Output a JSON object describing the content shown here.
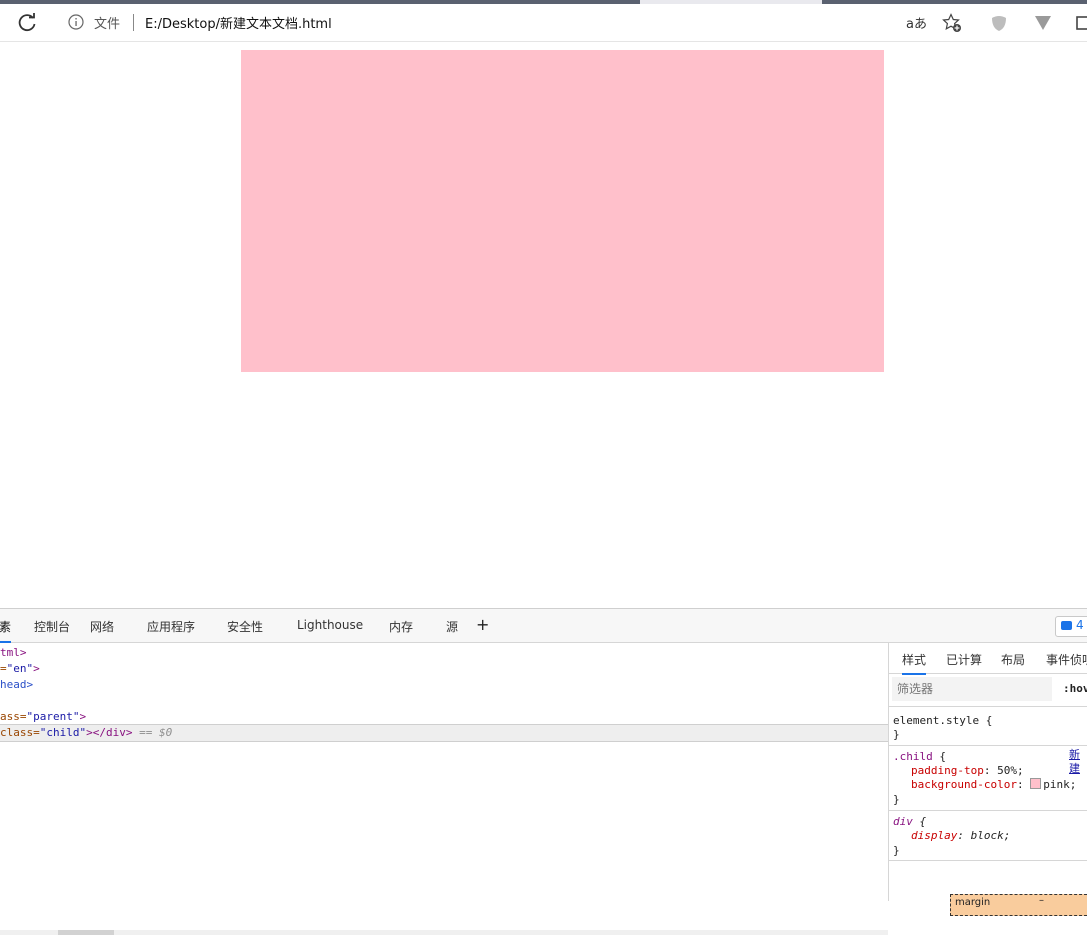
{
  "browser": {
    "file_label": "文件",
    "url": "E:/Desktop/新建文本文档.html",
    "read_aloud_label": "aあ",
    "icons": [
      "reload-icon",
      "info-icon",
      "favorites-star-icon",
      "extension-icon"
    ]
  },
  "page": {
    "child_color": "#ffc0cb"
  },
  "devtools": {
    "tabs": [
      "素",
      "控制台",
      "网络",
      "应用程序",
      "安全性",
      "Lighthouse",
      "内存",
      "源"
    ],
    "plus_label": "+",
    "issues_count": "4",
    "dom": {
      "line1_tag": "tml>",
      "line2_attr_tail": "=",
      "line2_val": "\"en\"",
      "line2_close": ">",
      "line3_tag": "head>",
      "line5_attr": "ass=",
      "line5_val": "\"parent\"",
      "line5_close": ">",
      "line6_attr": "class=",
      "line6_val": "\"child\"",
      "line6_close": "></div>",
      "line6_eq": "== $0"
    },
    "styles": {
      "tabs": [
        "样式",
        "已计算",
        "布局",
        "事件侦听"
      ],
      "filter_placeholder": "筛选器",
      "hov_label": ":hov",
      "element_style_open": "element.style {",
      "element_style_close": "}",
      "child_selector": ".child",
      "child_brace": " {",
      "child_source": "新建",
      "padding_name": "padding-top",
      "padding_value": ": 50%;",
      "bg_name": "background-color",
      "bg_value": "pink;",
      "child_close": "}",
      "div_selector": "div",
      "div_brace": " {",
      "display_name": "display",
      "display_value": ": block;",
      "div_close": "}",
      "box_label": "margin",
      "box_value": "–"
    }
  }
}
